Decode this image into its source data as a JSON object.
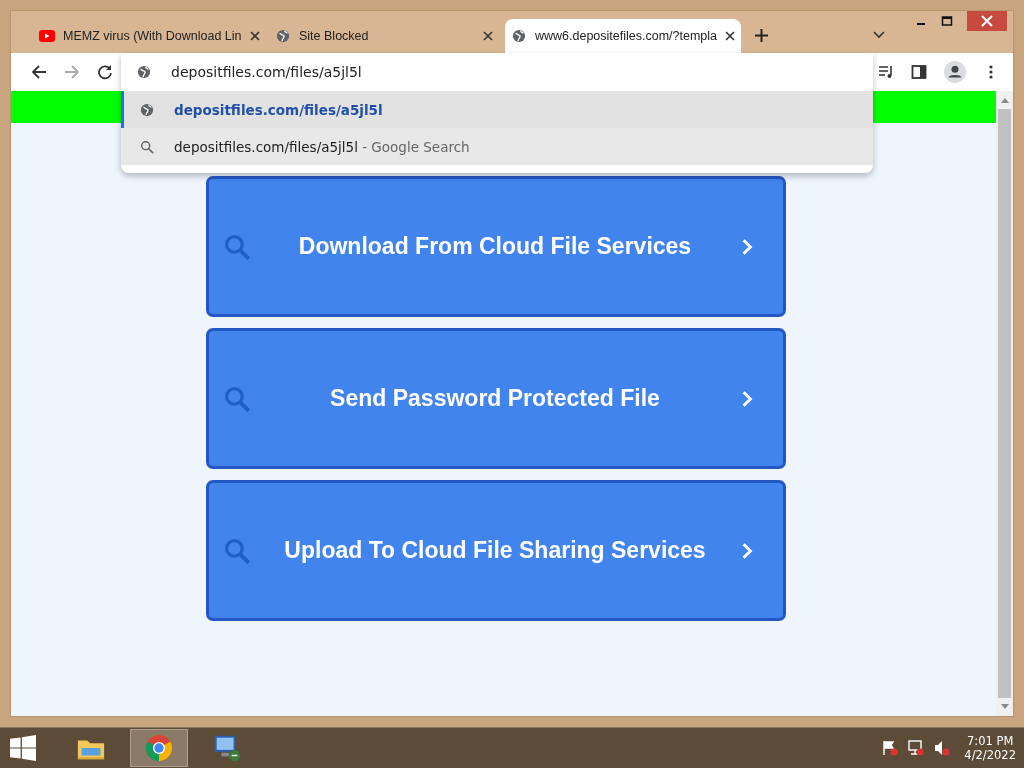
{
  "browser": {
    "tabs": [
      {
        "title": "MEMZ virus (With Download Lin",
        "kind": "youtube",
        "selected": false
      },
      {
        "title": "Site Blocked",
        "kind": "globe",
        "selected": false
      },
      {
        "title": "www6.depositefiles.com/?templa",
        "kind": "globe",
        "selected": true
      }
    ],
    "omnibox": {
      "value": "depositfiles.com/files/a5jl5l"
    },
    "suggestions": [
      {
        "kind": "url",
        "text": "depositfiles.com/files/a5jl5l",
        "selected": true
      },
      {
        "kind": "search",
        "text": "depositfiles.com/files/a5jl5l",
        "suffix": " - Google Search",
        "selected": false
      }
    ]
  },
  "page": {
    "buttons": [
      "Download From Cloud File Services",
      "Send Password Protected File",
      "Upload To Cloud File Sharing Services"
    ]
  },
  "taskbar": {
    "apps": [
      {
        "kind": "explorer",
        "selected": false
      },
      {
        "kind": "chrome",
        "selected": true
      },
      {
        "kind": "remote",
        "selected": false
      }
    ],
    "time": "7:01 PM",
    "date": "4/2/2022"
  }
}
